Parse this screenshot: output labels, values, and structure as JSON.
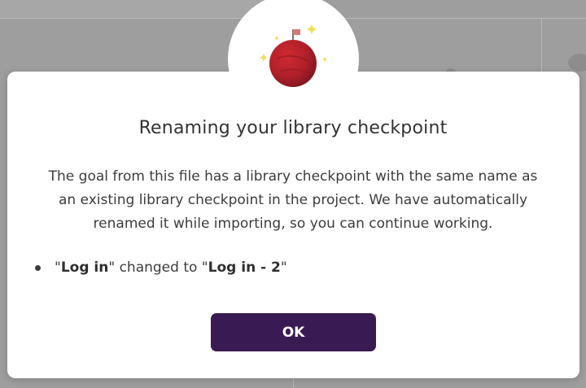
{
  "dialog": {
    "title": "Renaming your library checkpoint",
    "message_lines": [
      "The goal from this file has a library checkpoint with the same name as",
      "an existing library checkpoint in the project. We have automatically",
      "renamed it while importing, so you can continue working."
    ],
    "changes": [
      {
        "quote_open": "\"",
        "old_name": "Log in",
        "middle": "\" changed to \"",
        "new_name": "Log in - 2",
        "quote_close": "\""
      }
    ],
    "ok_label": "OK"
  },
  "colors": {
    "ok_button": "#3a1a52",
    "planet": "#b0202a",
    "flag": "#d97878",
    "sparkle": "#f2dc5a"
  },
  "icons": {
    "illustration": "planet-with-flag-icon"
  }
}
